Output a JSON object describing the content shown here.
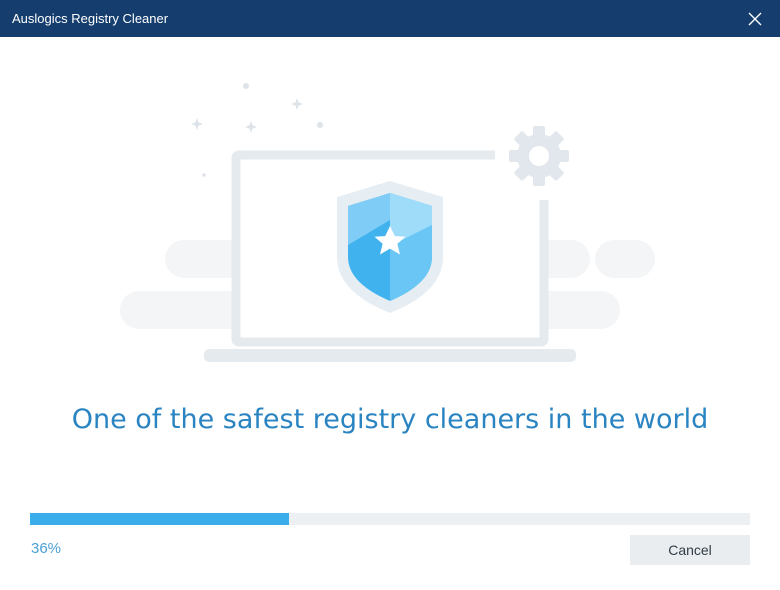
{
  "window": {
    "title": "Auslogics Registry Cleaner"
  },
  "main": {
    "headline": "One of the safest registry cleaners in the world"
  },
  "progress": {
    "value": 0.36,
    "label": "36%"
  },
  "buttons": {
    "cancel_label": "Cancel"
  },
  "icons": {
    "close": "close-icon",
    "illustration": "laptop-shield-icon",
    "shield": "shield-icon",
    "gear": "gear-icon"
  },
  "colors": {
    "titlebar": "#153e6f",
    "accent": "#3aaeea",
    "headline": "#2a84c1"
  }
}
